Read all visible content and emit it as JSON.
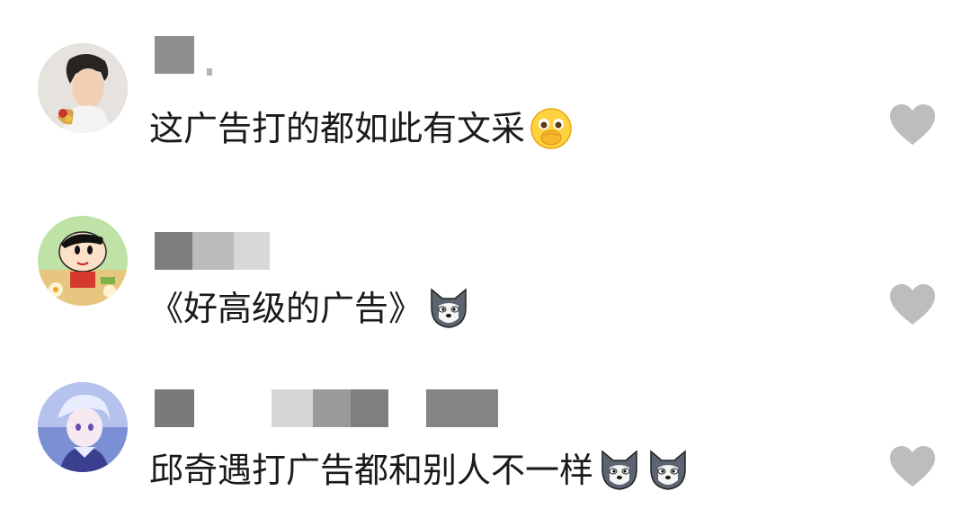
{
  "comments": [
    {
      "avatar": "avatar-young-man",
      "text": "这广告打的都如此有文采",
      "emojis": [
        "hand-over-mouth-emoji"
      ],
      "like_icon": "heart-icon"
    },
    {
      "avatar": "avatar-cartoon-boy",
      "text": "《好高级的广告》",
      "emojis": [
        "husky-dog-emoji"
      ],
      "like_icon": "heart-icon"
    },
    {
      "avatar": "avatar-anime-character",
      "text": "邱奇遇打广告都和别人不一样",
      "emojis": [
        "husky-dog-emoji",
        "husky-dog-emoji"
      ],
      "like_icon": "heart-icon"
    }
  ],
  "colors": {
    "text": "#1a1a1a",
    "heart": "#bdbdbd",
    "background": "#ffffff"
  }
}
